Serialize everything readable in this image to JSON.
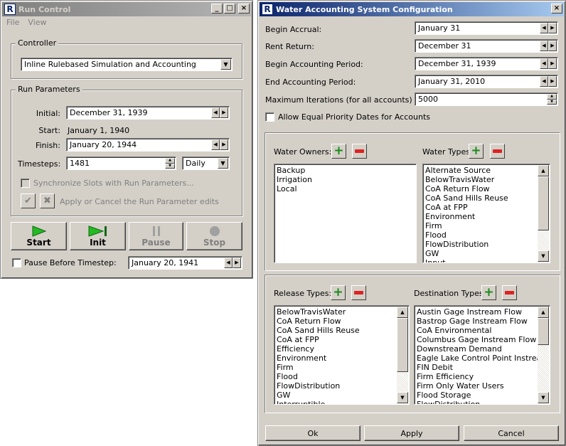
{
  "run_control": {
    "title": "Run Control",
    "menu": [
      "File",
      "View"
    ],
    "controller": {
      "label": "Controller",
      "value": "Inline Rulebased Simulation and Accounting"
    },
    "run_parameters": {
      "label": "Run Parameters",
      "initial_label": "Initial:",
      "initial_value": "December 31, 1939",
      "start_label": "Start:",
      "start_value": "January 1, 1940",
      "finish_label": "Finish:",
      "finish_value": "January 20, 1944",
      "timesteps_label": "Timesteps:",
      "timesteps_value": "1481",
      "timestep_unit": "Daily",
      "sync_label": "Synchronize Slots with Run Parameters...",
      "apply_cancel_label": "Apply or Cancel the Run Parameter edits"
    },
    "buttons": {
      "start": "Start",
      "init": "Init",
      "pause": "Pause",
      "stop": "Stop"
    },
    "pause_before_label": "Pause Before Timestep:",
    "pause_before_value": "January 20, 1941"
  },
  "wasc": {
    "title": "Water Accounting System Configuration",
    "begin_accrual_label": "Begin Accrual:",
    "begin_accrual_value": "January 31",
    "rent_return_label": "Rent Return:",
    "rent_return_value": "December 31",
    "begin_period_label": "Begin Accounting Period:",
    "begin_period_value": "December 31, 1939",
    "end_period_label": "End Accounting Period:",
    "end_period_value": "January 31, 2010",
    "max_iter_label": "Maximum Iterations (for all accounts)",
    "max_iter_value": "5000",
    "allow_equal_label": "Allow Equal Priority Dates for Accounts",
    "water_owners_label": "Water Owners:",
    "water_owners": [
      "Backup",
      "Irrigation",
      "Local"
    ],
    "water_types_label": "Water Types",
    "water_types": [
      "Alternate Source",
      "BelowTravisWater",
      "CoA Return Flow",
      "CoA Sand Hills Reuse",
      "CoA at FPP",
      "Environment",
      "Firm",
      "Flood",
      "FlowDistribution",
      "GW",
      "Input"
    ],
    "release_types_label": "Release Types:",
    "release_types": [
      "BelowTravisWater",
      "CoA Return Flow",
      "CoA Sand Hills Reuse",
      "CoA at FPP",
      "Efficiency",
      "Environment",
      "Firm",
      "Flood",
      "FlowDistribution",
      "GW",
      "Interruptible"
    ],
    "destination_types_label": "Destination Types:",
    "destination_types": [
      "Austin Gage Instream Flow",
      "Bastrop Gage Instream Flow",
      "CoA Environmental",
      "Columbus Gage Instream Flow",
      "Downstream Demand",
      "Eagle Lake Control Point Instrea...",
      "FIN Debit",
      "Firm Efficiency",
      "Firm Only Water Users",
      "Flood Storage",
      "FlowDistribution"
    ],
    "ok_label": "Ok",
    "apply_label": "Apply",
    "cancel_label": "Cancel"
  },
  "window_controls": {
    "minimize": "_",
    "maximize": "□",
    "close": "×"
  }
}
